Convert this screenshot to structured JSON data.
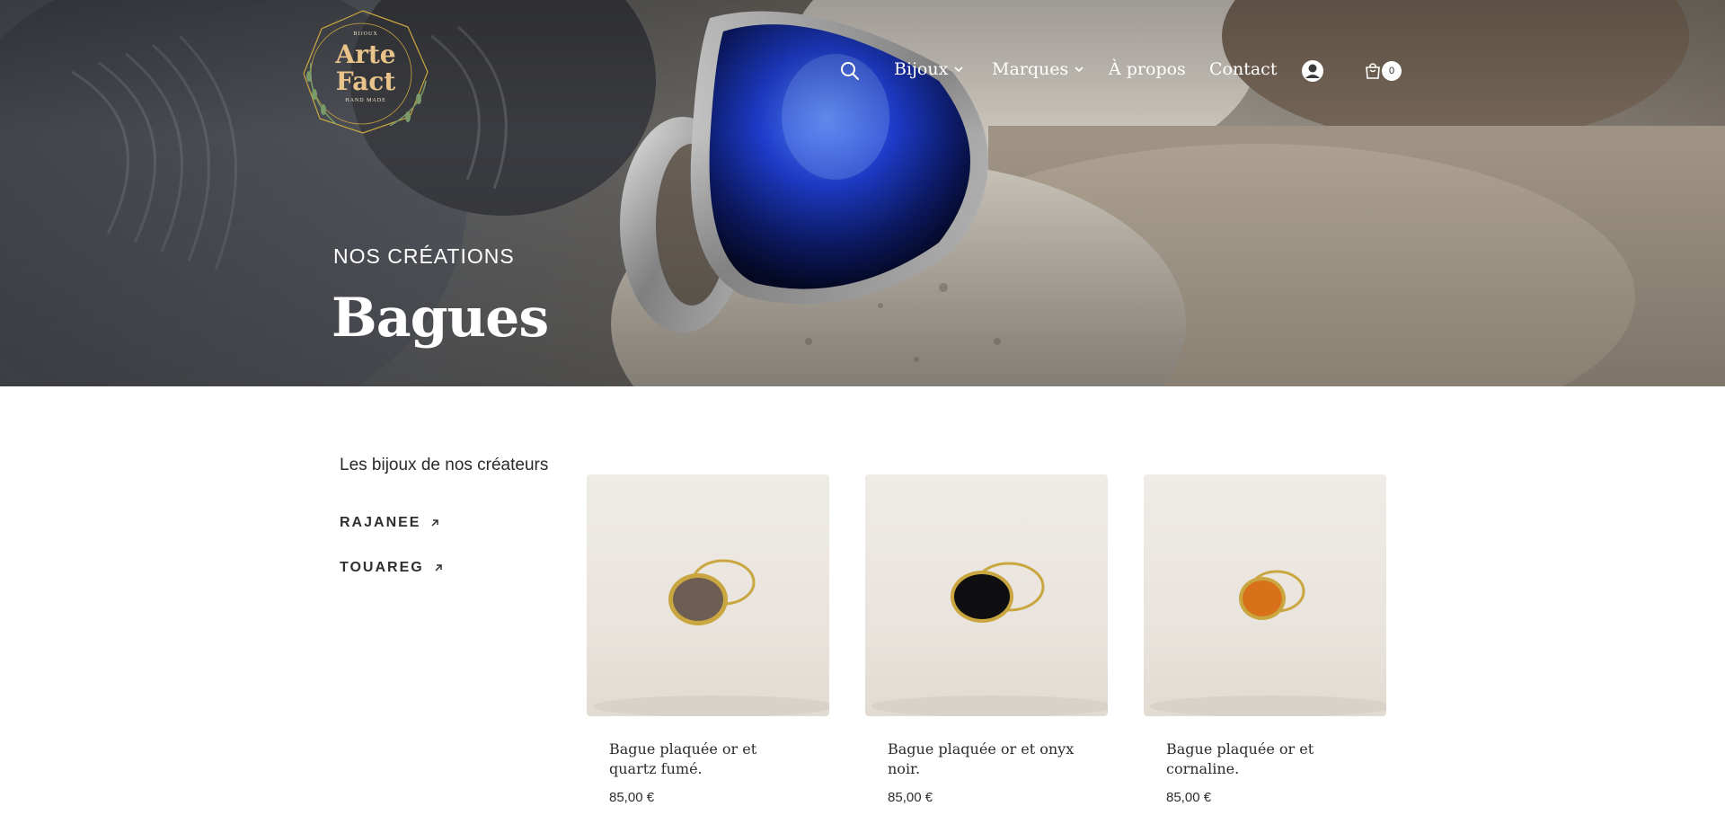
{
  "logo": {
    "top_text": "BIJOUX",
    "line1": "Arte",
    "line2": "Fact",
    "bottom_text": "HAND MADE"
  },
  "nav": {
    "items": [
      {
        "label": "Bijoux",
        "has_dropdown": true
      },
      {
        "label": "Marques",
        "has_dropdown": true
      },
      {
        "label": "À propos",
        "has_dropdown": false
      },
      {
        "label": "Contact",
        "has_dropdown": false
      }
    ],
    "search_icon": "search-icon",
    "account_icon": "account-icon",
    "cart_icon": "cart-icon",
    "cart_count": "0"
  },
  "hero": {
    "eyebrow": "NOS CRÉATIONS",
    "title": "Bagues"
  },
  "sidebar": {
    "title": "Les bijoux de nos créateurs",
    "brands": [
      {
        "label": "RAJANEE"
      },
      {
        "label": "TOUAREG"
      }
    ]
  },
  "products": [
    {
      "name": "Bague plaquée or et quartz fumé.",
      "price": "85,00 €",
      "stone_color": "#6e5d52"
    },
    {
      "name": "Bague plaquée or et onyx noir.",
      "price": "85,00 €",
      "stone_color": "#0f0f12"
    },
    {
      "name": "Bague plaquée or et cornaline.",
      "price": "85,00 €",
      "stone_color": "#d9711b"
    }
  ],
  "colors": {
    "text": "#2a2a2a",
    "gold": "#c9a640",
    "logo_gold": "#e8c38a"
  }
}
